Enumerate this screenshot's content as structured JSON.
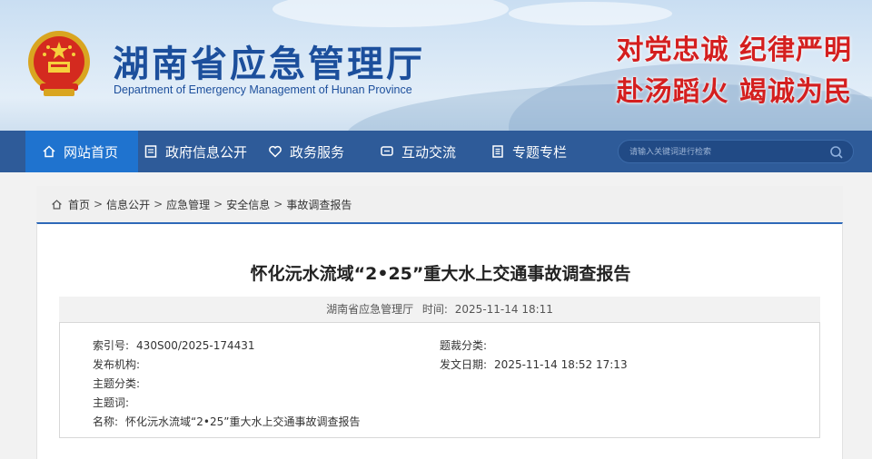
{
  "header": {
    "title": "湖南省应急管理厅",
    "subtitle": "Department of Emergency Management of Hunan Province",
    "slogan_line1": "对党忠诚  纪律严明",
    "slogan_line2": "赴汤蹈火  竭诚为民",
    "colors": {
      "title": "#1c4f9c",
      "slogan": "#d41f1f"
    }
  },
  "nav": {
    "items": [
      {
        "label": "网站首页",
        "icon": "home-icon"
      },
      {
        "label": "政府信息公开",
        "icon": "document-icon"
      },
      {
        "label": "政务服务",
        "icon": "heart-icon"
      },
      {
        "label": "互动交流",
        "icon": "chat-icon"
      },
      {
        "label": "专题专栏",
        "icon": "topic-icon"
      }
    ],
    "search_placeholder": "请输入关键词进行检索",
    "colors": {
      "bar": "#2e5b99",
      "active": "#1f73cf"
    }
  },
  "breadcrumb": {
    "items": [
      "首页",
      "信息公开",
      "应急管理",
      "安全信息",
      "事故调查报告"
    ],
    "separator": ">"
  },
  "article": {
    "title": "怀化沅水流域“2•25”重大水上交通事故调查报告",
    "source": "湖南省应急管理厅",
    "time_label": "时间:",
    "time": "2025-11-14 18:11",
    "info": {
      "index_label": "索引号:",
      "index_value": "430S00/2025-174431",
      "genre_label": "题裁分类:",
      "genre_value": "",
      "publisher_label": "发布机构:",
      "publisher_value": "",
      "date_label": "发文日期:",
      "date_value": "2025-11-14 18:52 17:13",
      "topic_label": "主题分类:",
      "topic_value": "",
      "keywords_label": "主题词:",
      "keywords_value": "",
      "name_label": "名称:",
      "name_value": "怀化沅水流域“2•25”重大水上交通事故调查报告"
    }
  }
}
